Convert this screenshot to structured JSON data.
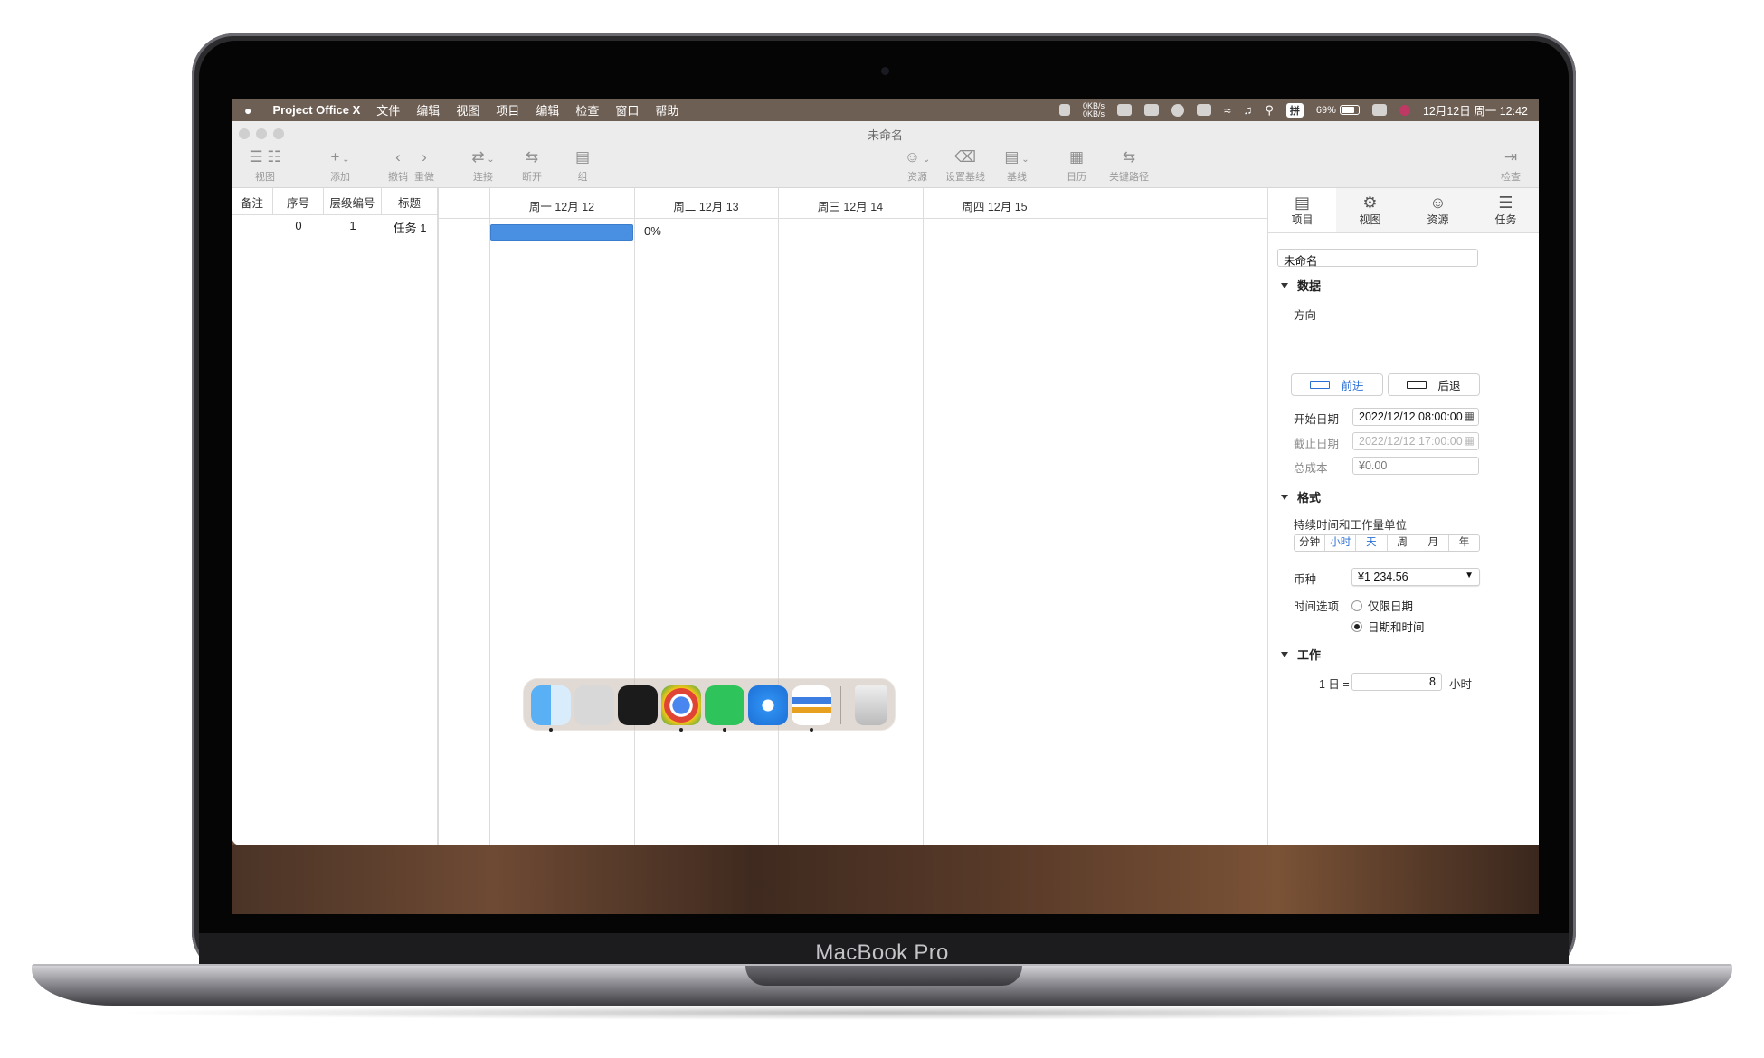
{
  "device": {
    "brand": "MacBook Pro"
  },
  "menubar": {
    "apple": "",
    "app_name": "Project Office X",
    "items": [
      "文件",
      "编辑",
      "视图",
      "项目",
      "编辑",
      "检查",
      "窗口",
      "帮助"
    ],
    "net_up": "0KB/s",
    "net_down": "0KB/s",
    "input_method": "拼",
    "battery": "69%",
    "battery_level": 0.69,
    "datetime": "12月12日 周一  12:42"
  },
  "window": {
    "title": "未命名",
    "toolbar": {
      "view": "视图",
      "add": "添加",
      "undo": "撤销",
      "redo": "重做",
      "link": "连接",
      "unlink": "断开",
      "group": "组",
      "resources": "资源",
      "set_baseline": "设置基线",
      "baseline": "基线",
      "calendar": "日历",
      "critical_path": "关键路径",
      "inspect": "检查"
    }
  },
  "table": {
    "headers": [
      "备注",
      "序号",
      "层级编号",
      "标题"
    ],
    "rows": [
      {
        "note": "",
        "index": "0",
        "wbs": "1",
        "title": "任务 1"
      }
    ]
  },
  "gantt": {
    "days": [
      "周一 12月 12",
      "周二 12月 13",
      "周三 12月 14",
      "周四 12月 15"
    ],
    "tasks": [
      {
        "progress_label": "0%",
        "progress": 0
      }
    ]
  },
  "inspector": {
    "tabs": [
      "项目",
      "视图",
      "资源",
      "任务"
    ],
    "project_name": "未命名",
    "data_section": "数据",
    "direction_label": "方向",
    "forward": "前进",
    "backward": "后退",
    "start_label": "开始日期",
    "start_value": "2022/12/12 08:00:00",
    "end_label": "截止日期",
    "end_value": "2022/12/12  17:00:00",
    "cost_label": "总成本",
    "cost_value": "¥0.00",
    "format_section": "格式",
    "units_label": "持续时间和工作量单位",
    "units": [
      "分钟",
      "小时",
      "天",
      "周",
      "月",
      "年"
    ],
    "units_selected": [
      "小时",
      "天"
    ],
    "currency_label": "币种",
    "currency_value": "¥1 234.56",
    "time_options_label": "时间选项",
    "date_only": "仅限日期",
    "date_time": "日期和时间",
    "work_section": "工作",
    "day_eq": "1 日 =",
    "hours_value": "8",
    "hours_unit": "小时"
  },
  "colors": {
    "accent": "#2a6fd6",
    "gantt_bar": "#4a90e2",
    "menubar": "#6e5f54"
  },
  "dock": {
    "apps": [
      "finder-icon",
      "launchpad-icon",
      "terminal-icon",
      "chrome-icon",
      "wechat-icon",
      "safari-icon",
      "project-office-icon",
      "trash-icon"
    ]
  }
}
